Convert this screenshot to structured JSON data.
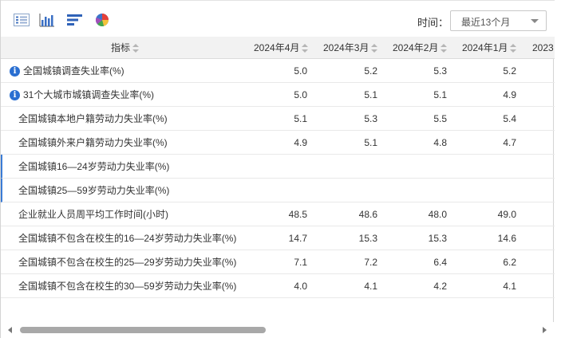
{
  "toolbar": {
    "icons": [
      "table-view-icon",
      "bar-chart-icon",
      "horizontal-bar-icon",
      "pie-chart-icon"
    ],
    "time_label": "时间：",
    "time_select_value": "最近13个月"
  },
  "table": {
    "header": {
      "indicator": "指标",
      "columns": [
        "2024年4月",
        "2024年3月",
        "2024年2月",
        "2024年1月",
        "2023"
      ]
    },
    "rows": [
      {
        "name": "全国城镇调查失业率(%)",
        "info": true,
        "values": [
          "5.0",
          "5.2",
          "5.3",
          "5.2"
        ]
      },
      {
        "name": "31个大城市城镇调查失业率(%)",
        "info": true,
        "values": [
          "5.0",
          "5.1",
          "5.1",
          "4.9"
        ]
      },
      {
        "name": "全国城镇本地户籍劳动力失业率(%)",
        "info": false,
        "values": [
          "5.1",
          "5.3",
          "5.5",
          "5.4"
        ]
      },
      {
        "name": "全国城镇外来户籍劳动力失业率(%)",
        "info": false,
        "values": [
          "4.9",
          "5.1",
          "4.8",
          "4.7"
        ]
      },
      {
        "name": "全国城镇16—24岁劳动力失业率(%)",
        "info": false,
        "values": [
          "",
          "",
          "",
          ""
        ]
      },
      {
        "name": "全国城镇25—59岁劳动力失业率(%)",
        "info": false,
        "values": [
          "",
          "",
          "",
          ""
        ]
      },
      {
        "name": "企业就业人员周平均工作时间(小时)",
        "info": false,
        "values": [
          "48.5",
          "48.6",
          "48.0",
          "49.0"
        ]
      },
      {
        "name": "全国城镇不包含在校生的16—24岁劳动力失业率(%)",
        "info": false,
        "values": [
          "14.7",
          "15.3",
          "15.3",
          "14.6"
        ]
      },
      {
        "name": "全国城镇不包含在校生的25—29岁劳动力失业率(%)",
        "info": false,
        "values": [
          "7.1",
          "7.2",
          "6.4",
          "6.2"
        ]
      },
      {
        "name": "全国城镇不包含在校生的30—59岁劳动力失业率(%)",
        "info": false,
        "values": [
          "4.0",
          "4.1",
          "4.2",
          "4.1"
        ]
      }
    ]
  },
  "colors": {
    "info_icon": "#2a6fd1",
    "header_bg": "#f2f2f2",
    "row_marker": "#3a7bd5",
    "scroll_thumb": "#a8a8a8"
  }
}
